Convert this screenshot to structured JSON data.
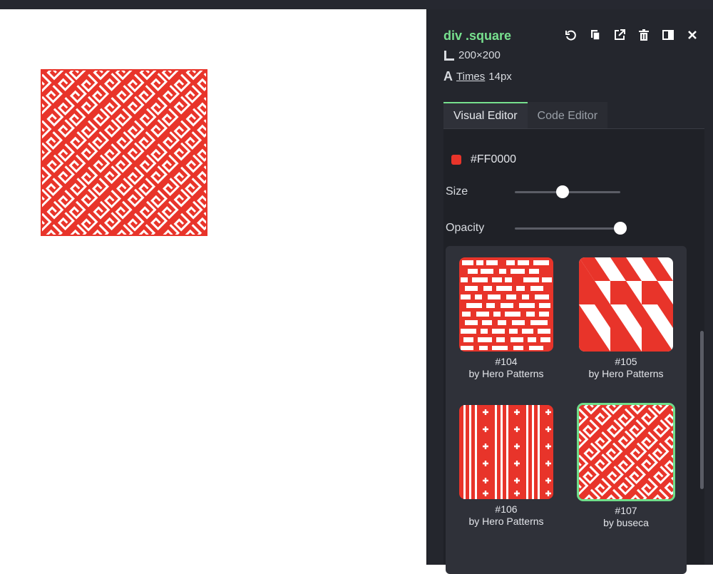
{
  "selection": {
    "title": "div .square",
    "size": "200×200",
    "font_name": "Times",
    "font_size": "14px"
  },
  "toolbar": {
    "icons": [
      "undo-icon",
      "copy-icon",
      "external-link-icon",
      "trash-icon",
      "panel-toggle-icon",
      "close-icon"
    ]
  },
  "tabs": [
    {
      "label": "Visual Editor",
      "active": true
    },
    {
      "label": "Code Editor",
      "active": false
    }
  ],
  "color": {
    "hex": "#FF0000",
    "swatch": "#e8342a"
  },
  "sliders": {
    "size": {
      "label": "Size",
      "value": 0.45
    },
    "opacity": {
      "label": "Opacity",
      "value": 1.0
    }
  },
  "patterns": [
    {
      "id": "#104",
      "author": "by Hero Patterns",
      "selected": false
    },
    {
      "id": "#105",
      "author": "by Hero Patterns",
      "selected": false
    },
    {
      "id": "#106",
      "author": "by Hero Patterns",
      "selected": false
    },
    {
      "id": "#107",
      "author": "by buseca",
      "selected": true
    }
  ],
  "colors": {
    "accent_green": "#77e08e",
    "pattern_red": "#e8342a",
    "panel_bg": "#24262d"
  }
}
